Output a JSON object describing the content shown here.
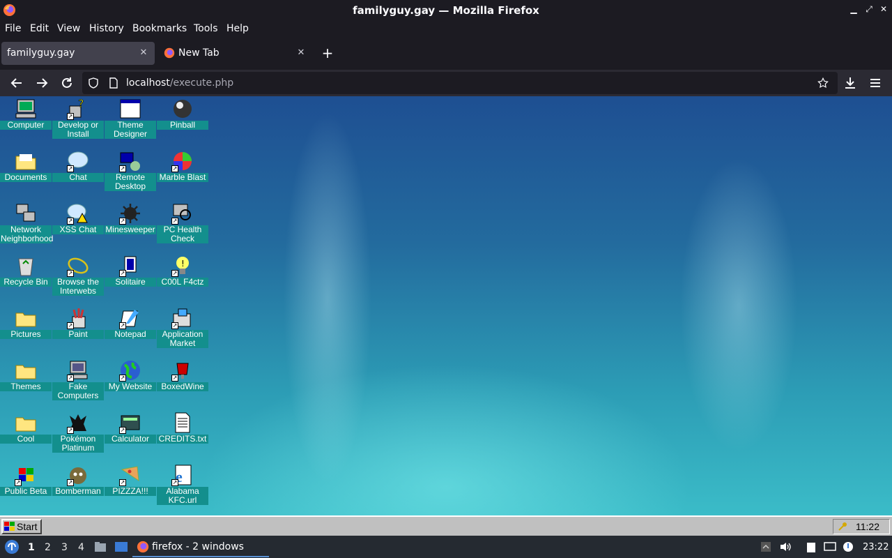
{
  "window": {
    "title": "familyguy.gay — Mozilla Firefox",
    "controls": [
      "minimize-icon",
      "maximize-icon",
      "close-icon"
    ]
  },
  "menu": [
    "File",
    "Edit",
    "View",
    "History",
    "Bookmarks",
    "Tools",
    "Help"
  ],
  "tabs": [
    {
      "label": "familyguy.gay",
      "active": true
    },
    {
      "label": "New Tab",
      "active": false
    }
  ],
  "urlbar": {
    "host": "localhost",
    "path": "/execute.php"
  },
  "desktop_icons": [
    {
      "label": "Computer",
      "icon": "computer-icon"
    },
    {
      "label": "Develop or Install",
      "icon": "develop-install-icon"
    },
    {
      "label": "Theme Designer",
      "icon": "theme-designer-icon"
    },
    {
      "label": "Pinball",
      "icon": "pinball-icon"
    },
    {
      "label": "Documents",
      "icon": "documents-folder-icon"
    },
    {
      "label": "Chat",
      "icon": "chat-icon"
    },
    {
      "label": "Remote Desktop",
      "icon": "remote-desktop-icon"
    },
    {
      "label": "Marble Blast",
      "icon": "marble-blast-icon"
    },
    {
      "label": "Network Neighborhood",
      "icon": "network-icon"
    },
    {
      "label": "XSS Chat",
      "icon": "xss-chat-icon"
    },
    {
      "label": "Minesweeper",
      "icon": "minesweeper-icon"
    },
    {
      "label": "PC Health Check",
      "icon": "pc-health-icon"
    },
    {
      "label": "Recycle Bin",
      "icon": "recycle-bin-icon"
    },
    {
      "label": "Browse the Interwebs",
      "icon": "browser-icon"
    },
    {
      "label": "Solitaire",
      "icon": "solitaire-icon"
    },
    {
      "label": "C00L F4ctz",
      "icon": "bulb-icon"
    },
    {
      "label": "Pictures",
      "icon": "pictures-folder-icon"
    },
    {
      "label": "Paint",
      "icon": "paint-icon"
    },
    {
      "label": "Notepad",
      "icon": "notepad-icon"
    },
    {
      "label": "Application Market",
      "icon": "app-market-icon"
    },
    {
      "label": "Themes",
      "icon": "themes-folder-icon"
    },
    {
      "label": "Fake Computers",
      "icon": "fake-computers-icon"
    },
    {
      "label": "My Website",
      "icon": "globe-icon"
    },
    {
      "label": "BoxedWine",
      "icon": "boxedwine-icon"
    },
    {
      "label": "Cool",
      "icon": "cool-folder-icon"
    },
    {
      "label": "Pokémon Platinum",
      "icon": "pokemon-icon"
    },
    {
      "label": "Calculator",
      "icon": "calculator-icon"
    },
    {
      "label": "CREDITS.txt",
      "icon": "text-file-icon"
    },
    {
      "label": "Public Beta",
      "icon": "windows-logo-icon"
    },
    {
      "label": "Bomberman",
      "icon": "bomberman-icon"
    },
    {
      "label": "PIZZZA!!!",
      "icon": "pizza-icon"
    },
    {
      "label": "Alabama KFC.url",
      "icon": "ie-icon"
    }
  ],
  "win98_taskbar": {
    "start_label": "Start",
    "clock": "11:22"
  },
  "host_panel": {
    "workspaces": [
      "1",
      "2",
      "3",
      "4"
    ],
    "current_workspace": "1",
    "task_label": "firefox - 2 windows",
    "clock": "23:22"
  },
  "colors": {
    "icon_label_bg": "#138f8d",
    "desktop_top": "#1e4f92",
    "desktop_bottom": "#3bbcc8"
  }
}
